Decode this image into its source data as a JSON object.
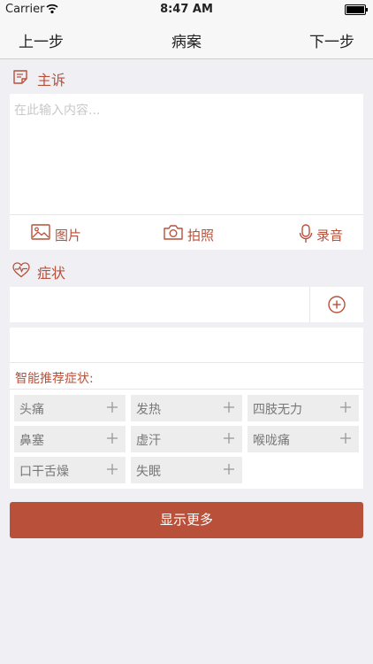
{
  "status": {
    "carrier": "Carrier",
    "time": "8:47 AM"
  },
  "nav": {
    "prev": "上一步",
    "title": "病案",
    "next": "下一步"
  },
  "complaint": {
    "title": "主诉",
    "placeholder": "在此输入内容...",
    "media": {
      "image": "图片",
      "camera": "拍照",
      "record": "录音"
    }
  },
  "symptoms": {
    "title": "症状",
    "recommend_label": "智能推荐症状:",
    "chips": [
      "头痛",
      "发热",
      "四肢无力",
      "鼻塞",
      "虚汗",
      "喉咙痛",
      "口干舌燥",
      "失眠"
    ]
  },
  "more_button": "显示更多",
  "colors": {
    "accent": "#b9503a",
    "background": "#efeff4"
  }
}
